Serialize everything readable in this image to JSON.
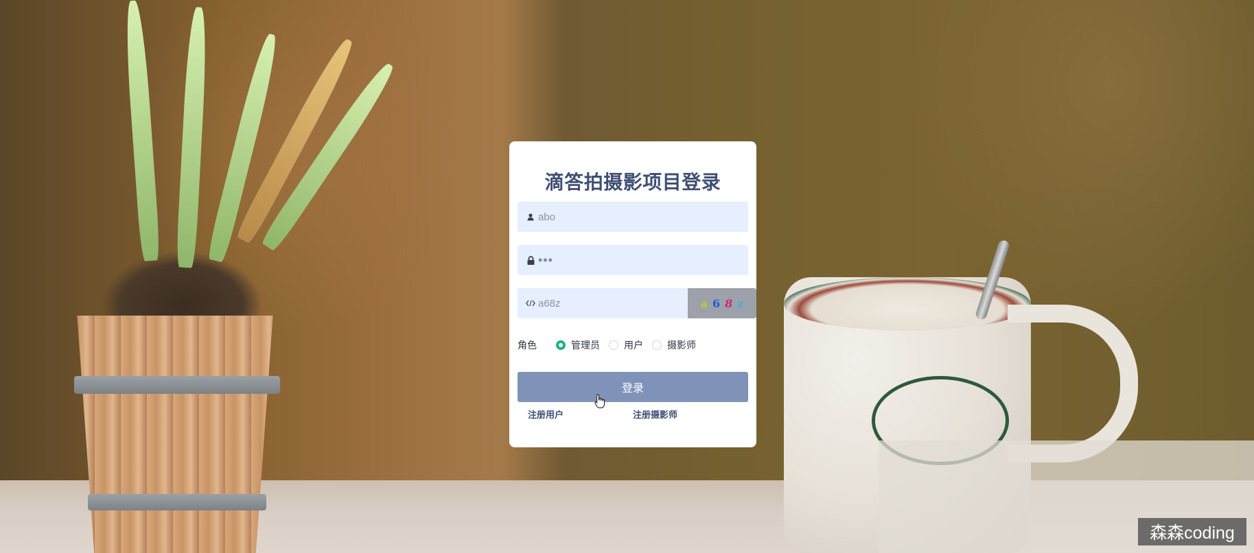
{
  "page": {
    "title": "滴答拍摄影项目登录"
  },
  "login_form": {
    "username": {
      "value": "abo",
      "icon": "user-icon"
    },
    "password": {
      "value": "•••",
      "icon": "lock-icon"
    },
    "captcha": {
      "value": "a68z",
      "icon": "code-icon",
      "image_chars": [
        "a",
        "6",
        "8",
        "z"
      ],
      "image_colors": [
        "#b6d12f",
        "#1e5bd6",
        "#d6237a",
        "#37b6d6"
      ]
    },
    "role": {
      "label": "角色",
      "options": [
        {
          "label": "管理员",
          "checked": true
        },
        {
          "label": "用户",
          "checked": false
        },
        {
          "label": "摄影师",
          "checked": false
        }
      ]
    },
    "submit_label": "登录",
    "links": {
      "register_user": "注册用户",
      "register_photographer": "注册摄影师"
    }
  },
  "watermark": {
    "text": "森森coding"
  },
  "colors": {
    "accent": "#1fb38a",
    "button": "#7f93b9",
    "field_bg": "#e6efff",
    "title": "#3f4f73"
  }
}
